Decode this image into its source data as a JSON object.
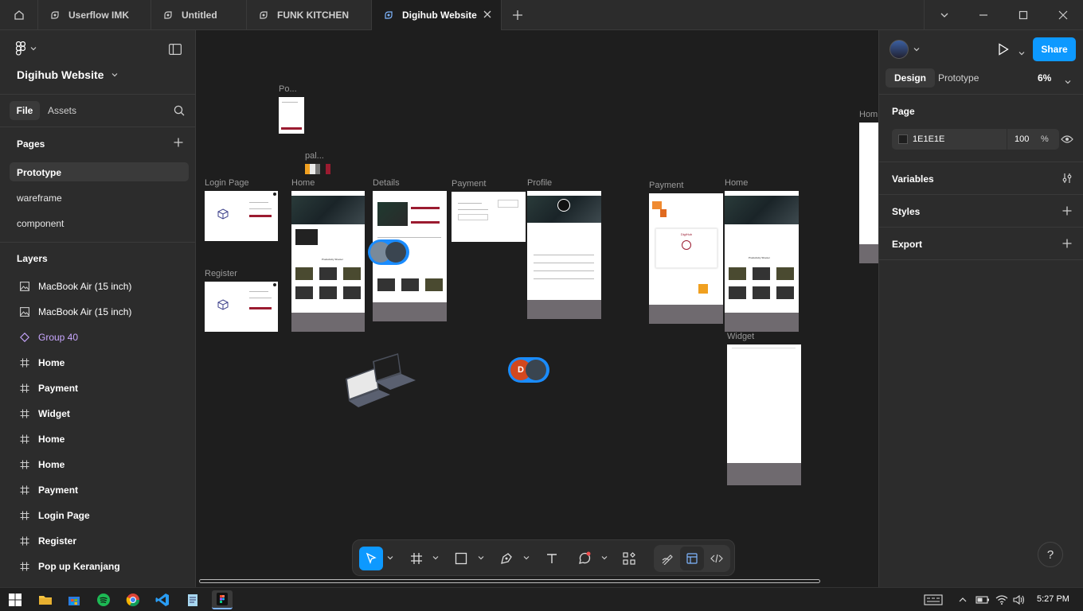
{
  "tabs": [
    {
      "label": "Userflow IMK"
    },
    {
      "label": "Untitled"
    },
    {
      "label": "FUNK KITCHEN"
    },
    {
      "label": "Digihub Website"
    }
  ],
  "file": {
    "name": "Digihub Website"
  },
  "left_tabs": {
    "file": "File",
    "assets": "Assets"
  },
  "pages": {
    "title": "Pages",
    "items": [
      {
        "label": "Prototype"
      },
      {
        "label": "wareframe"
      },
      {
        "label": "component"
      }
    ]
  },
  "layers": {
    "title": "Layers",
    "items": [
      {
        "label": "MacBook Air (15 inch)",
        "icon": "image-icon"
      },
      {
        "label": "MacBook Air (15 inch)",
        "icon": "image-icon"
      },
      {
        "label": "Group 40",
        "icon": "component-instance-icon"
      },
      {
        "label": "Home",
        "icon": "frame-icon"
      },
      {
        "label": "Payment",
        "icon": "frame-icon"
      },
      {
        "label": "Widget",
        "icon": "frame-icon"
      },
      {
        "label": "Home",
        "icon": "frame-icon"
      },
      {
        "label": "Home",
        "icon": "frame-icon"
      },
      {
        "label": "Payment",
        "icon": "frame-icon"
      },
      {
        "label": "Login Page",
        "icon": "frame-icon"
      },
      {
        "label": "Register",
        "icon": "frame-icon"
      },
      {
        "label": "Pop up Keranjang",
        "icon": "frame-icon"
      }
    ]
  },
  "right": {
    "share": "Share",
    "tab_design": "Design",
    "tab_prototype": "Prototype",
    "zoom": "6%",
    "page_title": "Page",
    "bg_hex": "1E1E1E",
    "bg_opacity": "100",
    "percent": "%",
    "variables": "Variables",
    "styles": "Styles",
    "export": "Export"
  },
  "canvas": {
    "frames": {
      "popup": "Po...",
      "palette": "pal...",
      "login": "Login Page",
      "register": "Register",
      "home1": "Home",
      "details": "Details",
      "payment1": "Payment",
      "profile": "Profile",
      "payment2": "Payment",
      "home2": "Home",
      "widget": "Widget",
      "home3": "Hom"
    },
    "avatar_letter": "D",
    "digihub_text": "DigiHub",
    "prod_title": "Productivity Shooter"
  },
  "help": "?",
  "taskbar": {
    "time": "5:27 PM"
  },
  "colors": {
    "accent": "#0d99ff",
    "panel": "#2c2c2c",
    "canvas": "#1e1e1e",
    "brand_red": "#9b1b30",
    "palette_orange": "#f0a020"
  }
}
